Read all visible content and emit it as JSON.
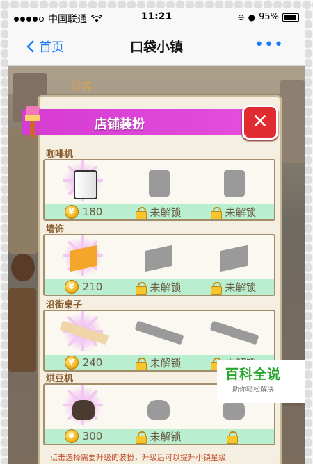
{
  "status_bar": {
    "carrier": "中国联通",
    "time": "11:21",
    "battery": "95%"
  },
  "nav": {
    "back_label": "首页",
    "title": "口袋小镇",
    "more_icon": "more-dots-icon"
  },
  "game": {
    "visitor_label": "访客",
    "dialog": {
      "title": "店铺装扮",
      "close_icon": "close-x-icon",
      "sections": [
        {
          "label": "咖啡机",
          "items": [
            {
              "kind": "price",
              "value": "180",
              "icon": "coffee-machine-icon"
            },
            {
              "kind": "locked",
              "value": "未解锁",
              "icon": "coffee-machine-locked-icon"
            },
            {
              "kind": "locked",
              "value": "未解锁",
              "icon": "coffee-machine-locked-icon"
            }
          ]
        },
        {
          "label": "墙饰",
          "items": [
            {
              "kind": "price",
              "value": "210",
              "icon": "wall-decor-icon"
            },
            {
              "kind": "locked",
              "value": "未解锁",
              "icon": "wall-decor-locked-icon"
            },
            {
              "kind": "locked",
              "value": "未解锁",
              "icon": "wall-decor-locked-icon"
            }
          ]
        },
        {
          "label": "沿街桌子",
          "items": [
            {
              "kind": "price",
              "value": "240",
              "icon": "street-table-icon"
            },
            {
              "kind": "locked",
              "value": "未解锁",
              "icon": "street-table-locked-icon"
            },
            {
              "kind": "locked",
              "value": "未解锁",
              "icon": "street-table-locked-icon"
            }
          ]
        },
        {
          "label": "烘豆机",
          "items": [
            {
              "kind": "price",
              "value": "300",
              "icon": "roaster-icon"
            },
            {
              "kind": "locked",
              "value": "未解锁",
              "icon": "roaster-locked-icon"
            },
            {
              "kind": "locked",
              "value": "",
              "icon": "roaster-locked-icon"
            }
          ]
        }
      ],
      "footer": "点击选择需要升级的装扮，升级后可以提升小镇星级"
    }
  },
  "watermark": {
    "title": "百科全说",
    "subtitle": "助你轻松解决"
  },
  "colors": {
    "header": "#d63bd2",
    "close": "#e02b31",
    "strip": "#b9eed0",
    "accent_blue": "#1a7cf5"
  }
}
